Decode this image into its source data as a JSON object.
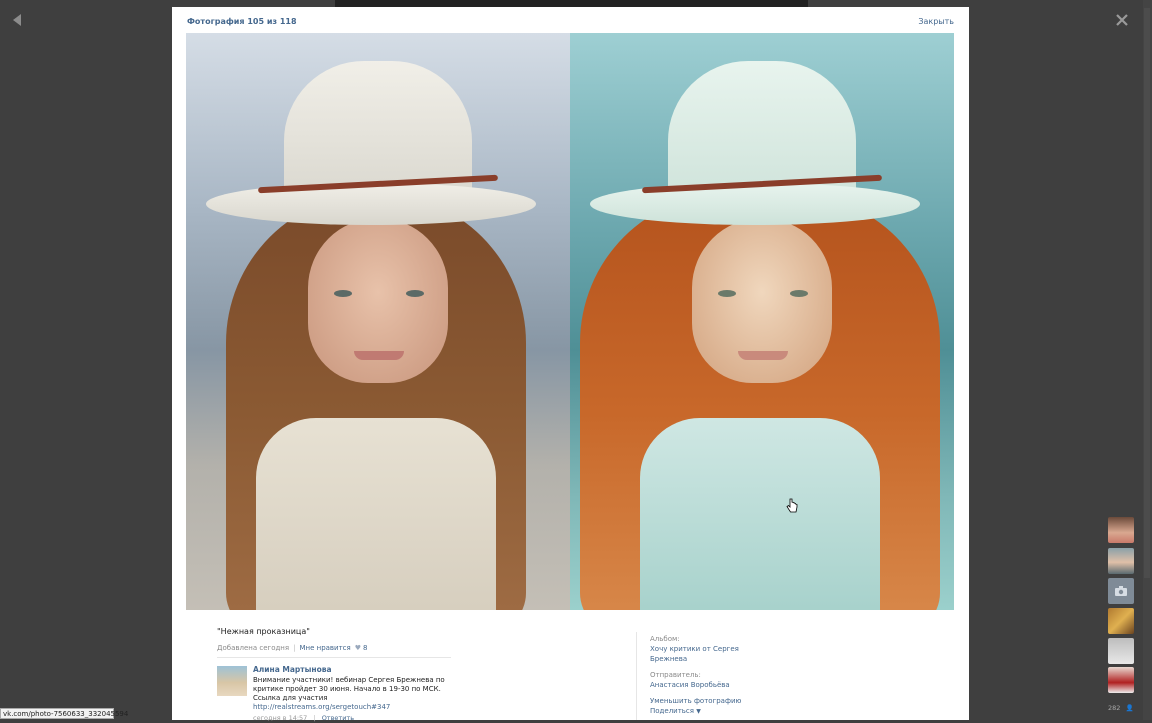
{
  "viewer": {
    "counter": "Фотография 105 из 118",
    "close_label": "Закрыть"
  },
  "caption": {
    "title": "\"Нежная проказница\"",
    "added": "Добавлена сегодня",
    "like_label": "Мне нравится",
    "like_count": "8"
  },
  "comment": {
    "author": "Алина Мартынова",
    "text": "Внимание участники! вебинар Сергея Брежнева по критике пройдет 30 июня. Начало в 19-30 по МСК.",
    "link_prefix": "Ссылка для участия",
    "link": "http://realstreams.org/sergetouch#347",
    "time": "сегодня в 14:57",
    "reply_label": "Ответить"
  },
  "info": {
    "album_label": "Альбом:",
    "album_name": "Хочу критики от Сергея Брежнева",
    "sender_label": "Отправитель:",
    "sender_name": "Анастасия Воробьёва",
    "reduce_label": "Уменьшить фотографию",
    "share_label": "Поделиться"
  },
  "status_bar": {
    "url": "vk.com/photo-7560633_332045594"
  },
  "rail": {
    "count": "282"
  },
  "icons": [
    "arrow-left-icon",
    "close-x-icon",
    "hand-cursor-icon",
    "heart-icon",
    "camera-icon",
    "person-icon",
    "chevron-down-icon"
  ]
}
